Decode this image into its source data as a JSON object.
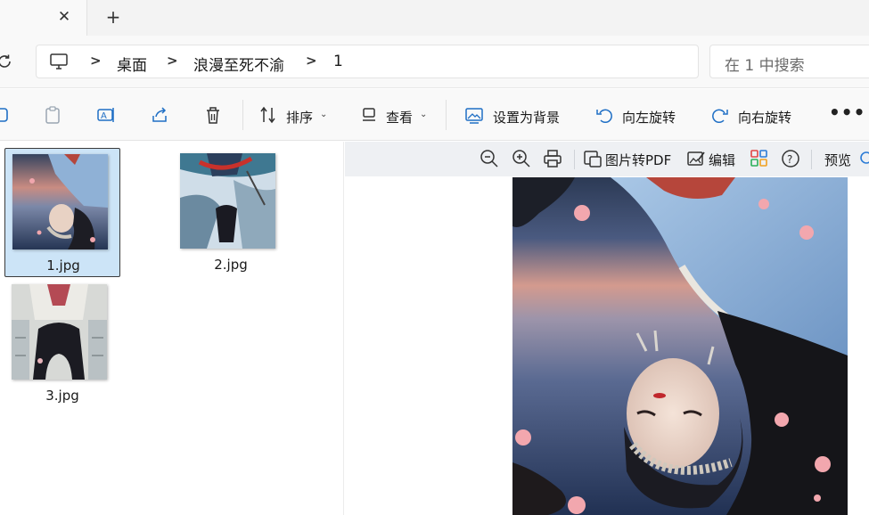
{
  "tabs": {
    "close_glyph": "✕",
    "new_tab_glyph": "+"
  },
  "address": {
    "crumbs": [
      "桌面",
      "浪漫至死不渝",
      "1"
    ],
    "separator": ">",
    "search_placeholder": "在 1 中搜索"
  },
  "commands": {
    "sort_label": "排序",
    "view_label": "查看",
    "set_background_label": "设置为背景",
    "rotate_left_label": "向左旋转",
    "rotate_right_label": "向右旋转",
    "more_glyph": "•••",
    "chevron": "⌄"
  },
  "files": [
    {
      "name": "1.jpg",
      "selected": true
    },
    {
      "name": "2.jpg",
      "selected": false
    },
    {
      "name": "3.jpg",
      "selected": false
    }
  ],
  "preview": {
    "to_pdf_label": "图片转PDF",
    "edit_label": "编辑",
    "preview_label": "预览",
    "help_glyph": "?"
  },
  "colors": {
    "selection": "#cce4f7",
    "accent": "#0067c0",
    "preview_toolbar": "#eef0f3"
  }
}
